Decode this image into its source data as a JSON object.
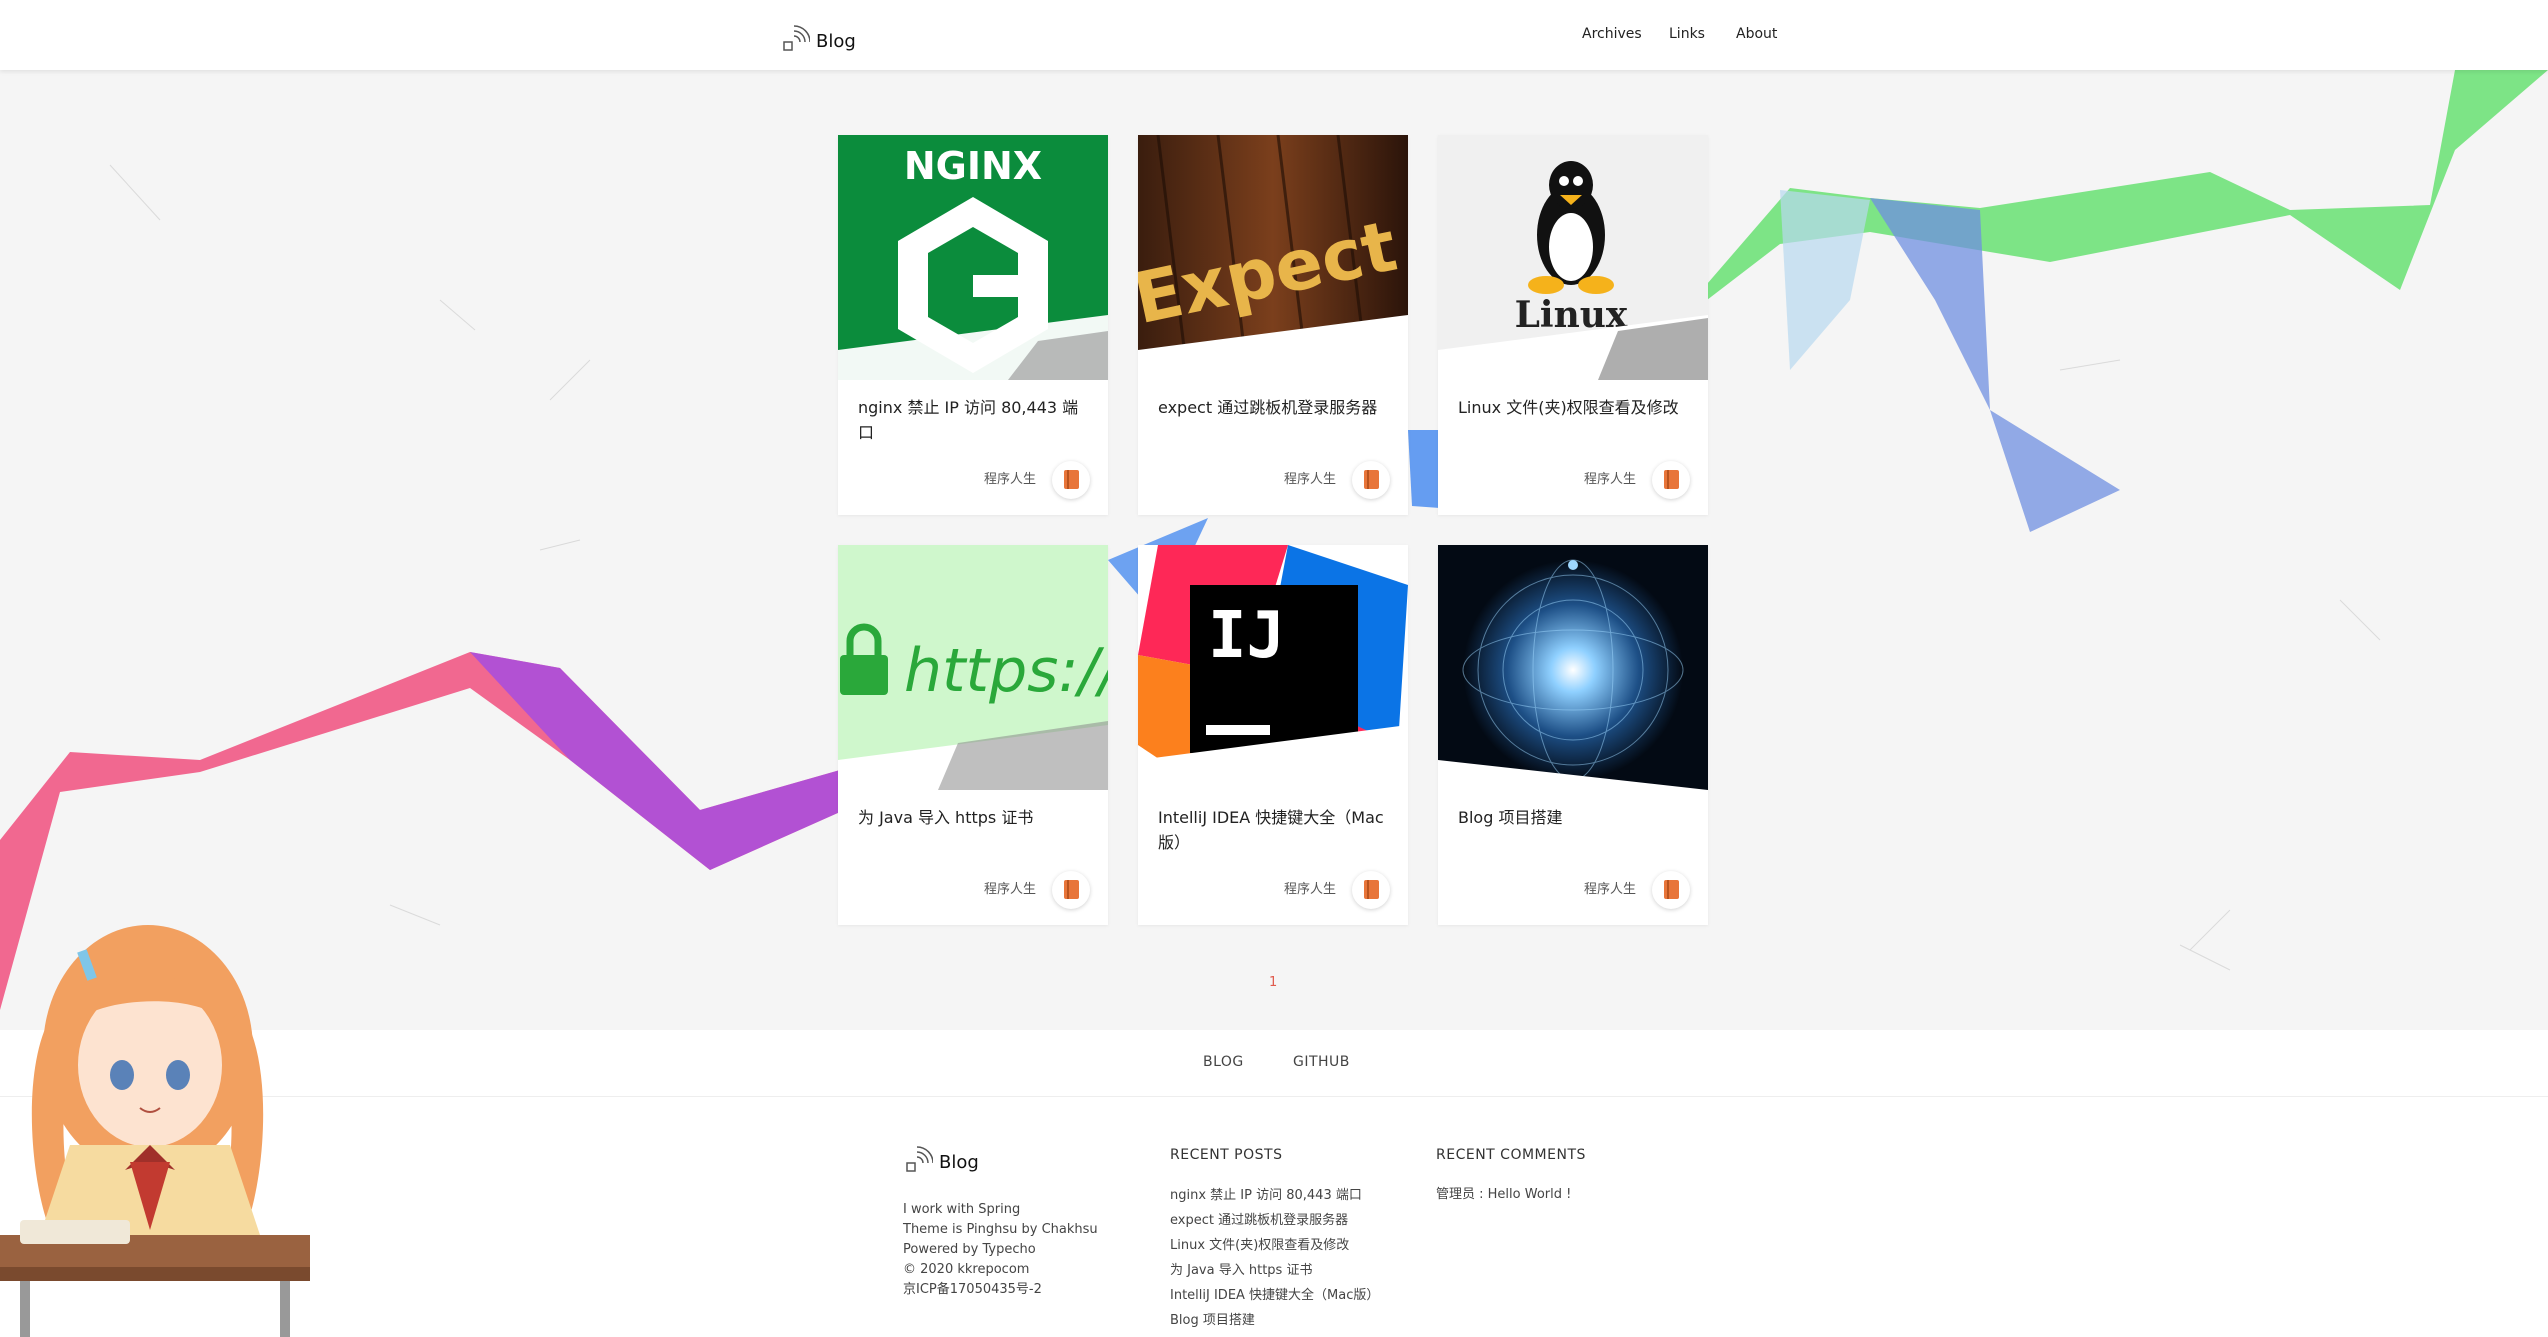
{
  "header": {
    "logo_text": "Blog",
    "nav": [
      "Archives",
      "Links",
      "About"
    ]
  },
  "posts": [
    {
      "title": "nginx 禁止 IP 访问 80,443 端口",
      "category": "程序人生",
      "thumb_text": "NGINX"
    },
    {
      "title": "expect 通过跳板机登录服务器",
      "category": "程序人生",
      "thumb_text": "Expect"
    },
    {
      "title": "Linux 文件(夹)权限查看及修改",
      "category": "程序人生",
      "thumb_text": "Linux"
    },
    {
      "title": "为 Java 导入 https 证书",
      "category": "程序人生",
      "thumb_text": "https://"
    },
    {
      "title": "IntelliJ IDEA 快捷键大全（Mac版）",
      "category": "程序人生",
      "thumb_text": "IJ"
    },
    {
      "title": "Blog 项目搭建",
      "category": "程序人生",
      "thumb_text": ""
    }
  ],
  "pagination": {
    "current": "1"
  },
  "links_bar": [
    "BLOG",
    "GITHUB"
  ],
  "footer": {
    "logo_text": "Blog",
    "about_lines": [
      "I work with Spring",
      "Theme is Pinghsu by Chakhsu",
      "Powered by Typecho",
      "© 2020 kkrepocom",
      "京ICP备17050435号-2"
    ],
    "recent_posts_title": "RECENT POSTS",
    "recent_posts": [
      "nginx 禁止 IP 访问 80,443 端口",
      "expect 通过跳板机登录服务器",
      "Linux 文件(夹)权限查看及修改",
      "为 Java 导入 https 证书",
      "IntelliJ IDEA 快捷键大全（Mac版）",
      "Blog 项目搭建"
    ],
    "recent_comments_title": "RECENT COMMENTS",
    "recent_comments": [
      "管理员 : Hello World !"
    ]
  },
  "colors": {
    "accent": "#e05a4d",
    "category_icon": "#e8753a"
  }
}
